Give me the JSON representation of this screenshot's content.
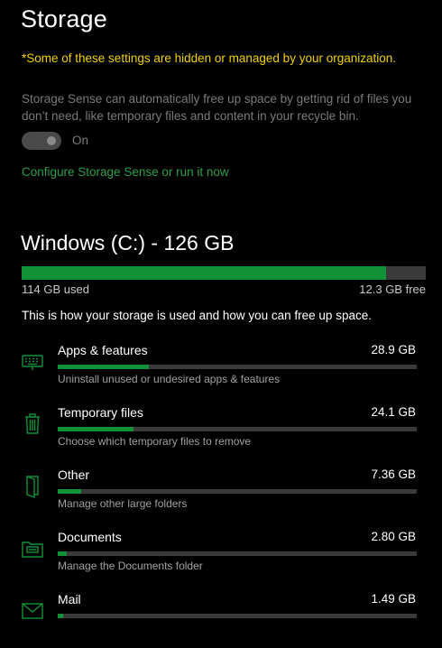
{
  "page": {
    "title": "Storage"
  },
  "notice": {
    "org": "*Some of these settings are hidden or managed by your organization."
  },
  "storage_sense": {
    "description": "Storage Sense can automatically free up space by getting rid of files you don’t need, like temporary files and content in your recycle bin.",
    "toggle_state": "On",
    "configure_link": "Configure Storage Sense or run it now"
  },
  "drive": {
    "title": "Windows (C:) - 126 GB",
    "used_label": "114 GB used",
    "free_label": "12.3 GB free",
    "used_fraction": 0.902
  },
  "usage_intro": "This is how your storage is used and how you can free up space.",
  "accent_color": "#119236",
  "categories": [
    {
      "icon": "keyboard-icon",
      "name": "Apps & features",
      "size": "28.9 GB",
      "desc": "Uninstall unused or undesired apps & features",
      "fraction": 0.255
    },
    {
      "icon": "trash-icon",
      "name": "Temporary files",
      "size": "24.1 GB",
      "desc": "Choose which temporary files to remove",
      "fraction": 0.21
    },
    {
      "icon": "document-icon",
      "name": "Other",
      "size": "7.36 GB",
      "desc": "Manage other large folders",
      "fraction": 0.065
    },
    {
      "icon": "folder-icon",
      "name": "Documents",
      "size": "2.80 GB",
      "desc": "Manage the Documents folder",
      "fraction": 0.025
    },
    {
      "icon": "mail-icon",
      "name": "Mail",
      "size": "1.49 GB",
      "desc": "",
      "fraction": 0.015
    }
  ]
}
